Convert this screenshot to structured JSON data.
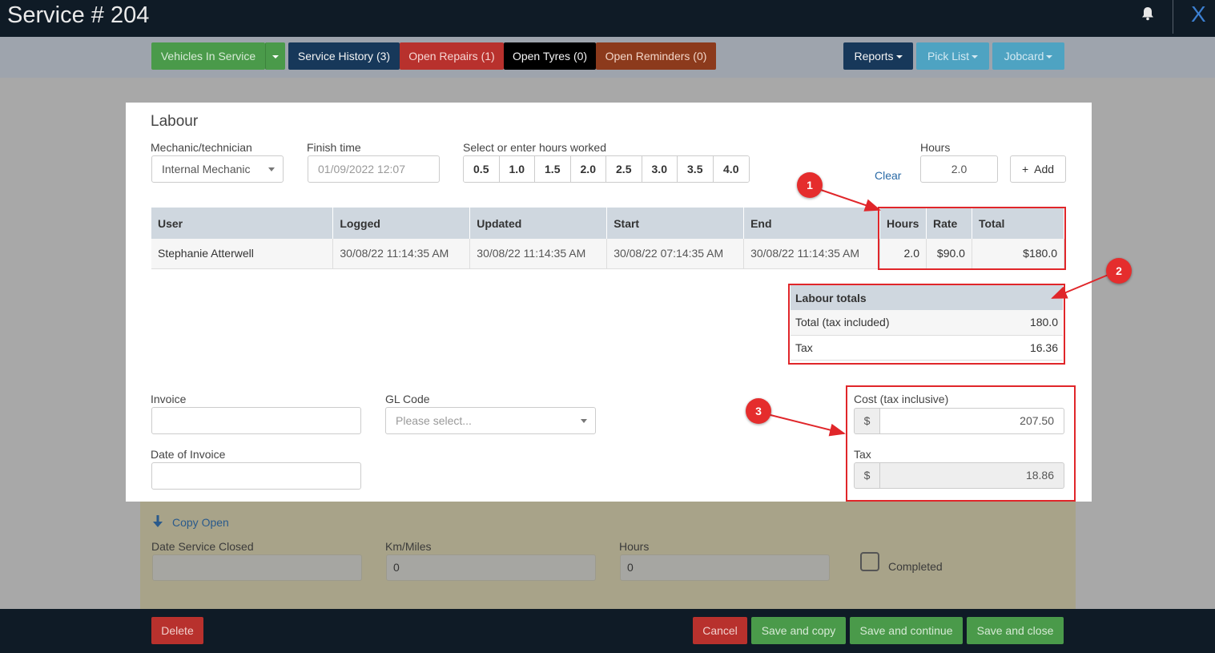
{
  "header": {
    "title": "Service # 204",
    "close_label": "X"
  },
  "toolbar": {
    "vehicles_in_service": "Vehicles In Service",
    "service_history": "Service History (3)",
    "open_repairs": "Open Repairs (1)",
    "open_tyres": "Open Tyres (0)",
    "open_reminders": "Open Reminders (0)",
    "reports": "Reports",
    "pick_list": "Pick List",
    "jobcard": "Jobcard"
  },
  "labour": {
    "title": "Labour",
    "mechanic_label": "Mechanic/technician",
    "mechanic_value": "Internal Mechanic",
    "finish_label": "Finish time",
    "finish_value": "01/09/2022 12:07",
    "hours_worked_label": "Select or enter hours worked",
    "hour_options": [
      "0.5",
      "1.0",
      "1.5",
      "2.0",
      "2.5",
      "3.0",
      "3.5",
      "4.0"
    ],
    "clear_label": "Clear",
    "hours_label": "Hours",
    "hours_value": "2.0",
    "add_label": "+  Add"
  },
  "table": {
    "columns": [
      "User",
      "Logged",
      "Updated",
      "Start",
      "End",
      "Hours",
      "Rate",
      "Total"
    ],
    "rows": [
      {
        "user": "Stephanie Atterwell",
        "logged": "30/08/22 11:14:35 AM",
        "updated": "30/08/22 11:14:35 AM",
        "start": "30/08/22 07:14:35 AM",
        "end": "30/08/22 11:14:35 AM",
        "hours": "2.0",
        "rate": "$90.0",
        "total": "$180.0"
      }
    ]
  },
  "totals": {
    "title": "Labour totals",
    "total_label": "Total (tax included)",
    "total_value": "180.0",
    "tax_label": "Tax",
    "tax_value": "16.36"
  },
  "invoice": {
    "invoice_label": "Invoice",
    "invoice_value": "",
    "gl_label": "GL Code",
    "gl_placeholder": "Please select...",
    "date_label": "Date of Invoice",
    "date_value": "",
    "cost_label": "Cost (tax inclusive)",
    "cost_value": "207.50",
    "tax_label": "Tax",
    "tax_value": "18.86",
    "currency": "$"
  },
  "annotations": [
    "1",
    "2",
    "3"
  ],
  "lower": {
    "copy_open": "Copy Open",
    "date_closed_label": "Date Service Closed",
    "km_label": "Km/Miles",
    "km_value": "0",
    "hours_label": "Hours",
    "hours_value": "0",
    "completed_label": "Completed"
  },
  "footer": {
    "delete": "Delete",
    "cancel": "Cancel",
    "save_copy": "Save and copy",
    "save_continue": "Save and continue",
    "save_close": "Save and close"
  },
  "colors": {
    "green": "#4a9a4a",
    "navy": "#17385a",
    "red": "#b8312d",
    "black": "#000000",
    "brown": "#8c3a1c",
    "teal": "#4ea3c2",
    "annotation_red": "#e0262a"
  }
}
